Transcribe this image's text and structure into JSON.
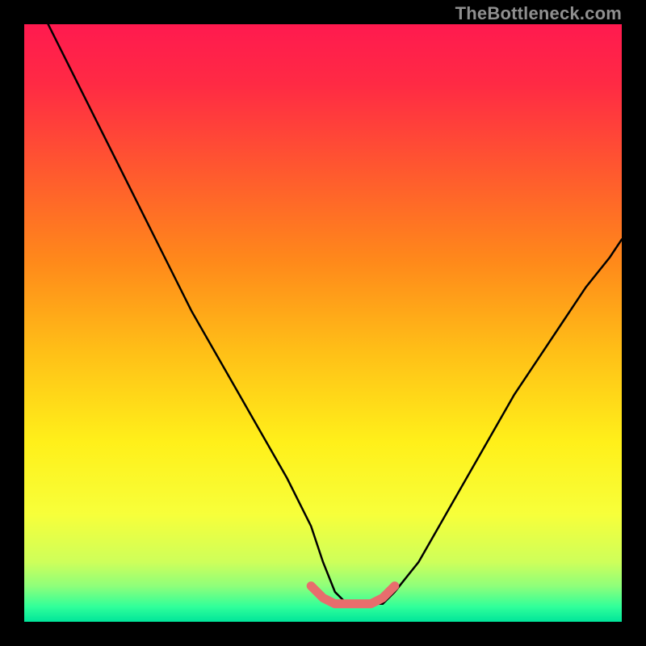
{
  "watermark": "TheBottleneck.com",
  "gradient": {
    "stops": [
      {
        "offset": 0.0,
        "color": "#ff1a4f"
      },
      {
        "offset": 0.1,
        "color": "#ff2a44"
      },
      {
        "offset": 0.25,
        "color": "#ff5a2e"
      },
      {
        "offset": 0.4,
        "color": "#ff8a1a"
      },
      {
        "offset": 0.55,
        "color": "#ffc017"
      },
      {
        "offset": 0.7,
        "color": "#fff01a"
      },
      {
        "offset": 0.82,
        "color": "#f7ff3a"
      },
      {
        "offset": 0.9,
        "color": "#ceff5a"
      },
      {
        "offset": 0.94,
        "color": "#8fff7a"
      },
      {
        "offset": 0.975,
        "color": "#30ff9a"
      },
      {
        "offset": 1.0,
        "color": "#00e59a"
      }
    ]
  },
  "chart_data": {
    "type": "line",
    "title": "",
    "xlabel": "",
    "ylabel": "",
    "xlim": [
      0,
      100
    ],
    "ylim": [
      0,
      100
    ],
    "series": [
      {
        "name": "bottleneck-curve",
        "x": [
          4,
          8,
          12,
          16,
          20,
          24,
          28,
          32,
          36,
          40,
          44,
          48,
          50,
          52,
          54,
          56,
          58,
          60,
          62,
          66,
          70,
          74,
          78,
          82,
          86,
          90,
          94,
          98,
          100
        ],
        "y": [
          100,
          92,
          84,
          76,
          68,
          60,
          52,
          45,
          38,
          31,
          24,
          16,
          10,
          5,
          3,
          3,
          3,
          3,
          5,
          10,
          17,
          24,
          31,
          38,
          44,
          50,
          56,
          61,
          64
        ]
      },
      {
        "name": "bottom-highlight",
        "x": [
          48,
          50,
          52,
          54,
          56,
          58,
          60,
          62
        ],
        "y": [
          6,
          4,
          3,
          3,
          3,
          3,
          4,
          6
        ]
      }
    ]
  }
}
